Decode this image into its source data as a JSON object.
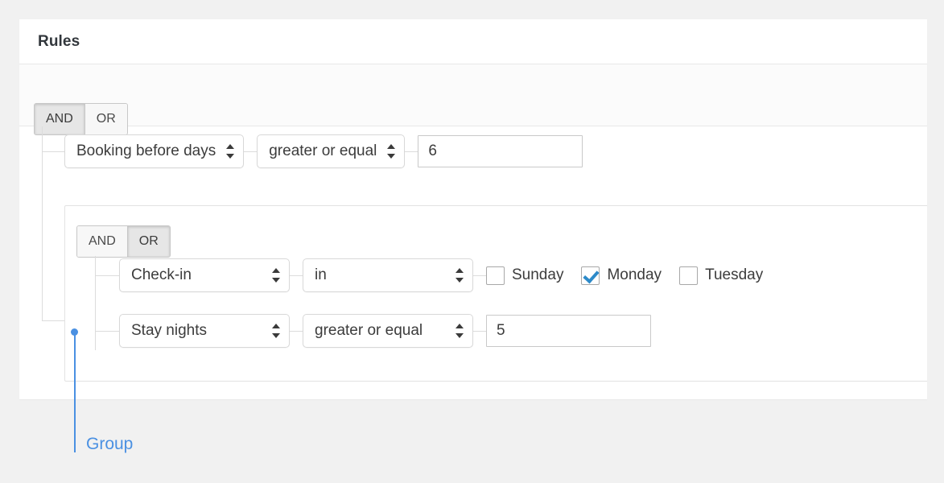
{
  "panel": {
    "title": "Rules"
  },
  "root_logic": {
    "and_label": "AND",
    "or_label": "OR",
    "active": "AND"
  },
  "rules": [
    {
      "field": "Booking before days",
      "operator": "greater or equal",
      "value": "6",
      "value_placeholder": ""
    }
  ],
  "group": {
    "logic": {
      "and_label": "AND",
      "or_label": "OR",
      "active": "OR"
    },
    "rules": [
      {
        "field": "Check-in",
        "operator": "in",
        "days": [
          {
            "label": "Sunday",
            "checked": false
          },
          {
            "label": "Monday",
            "checked": true
          },
          {
            "label": "Tuesday",
            "checked": false
          }
        ]
      },
      {
        "field": "Stay nights",
        "operator": "greater or equal",
        "value": "5",
        "value_placeholder": ""
      }
    ]
  },
  "annotation": {
    "label": "Group",
    "color": "#4a90e2"
  },
  "icons": {
    "stepper": "updown-stepper-icon",
    "checkmark": "check-icon"
  }
}
